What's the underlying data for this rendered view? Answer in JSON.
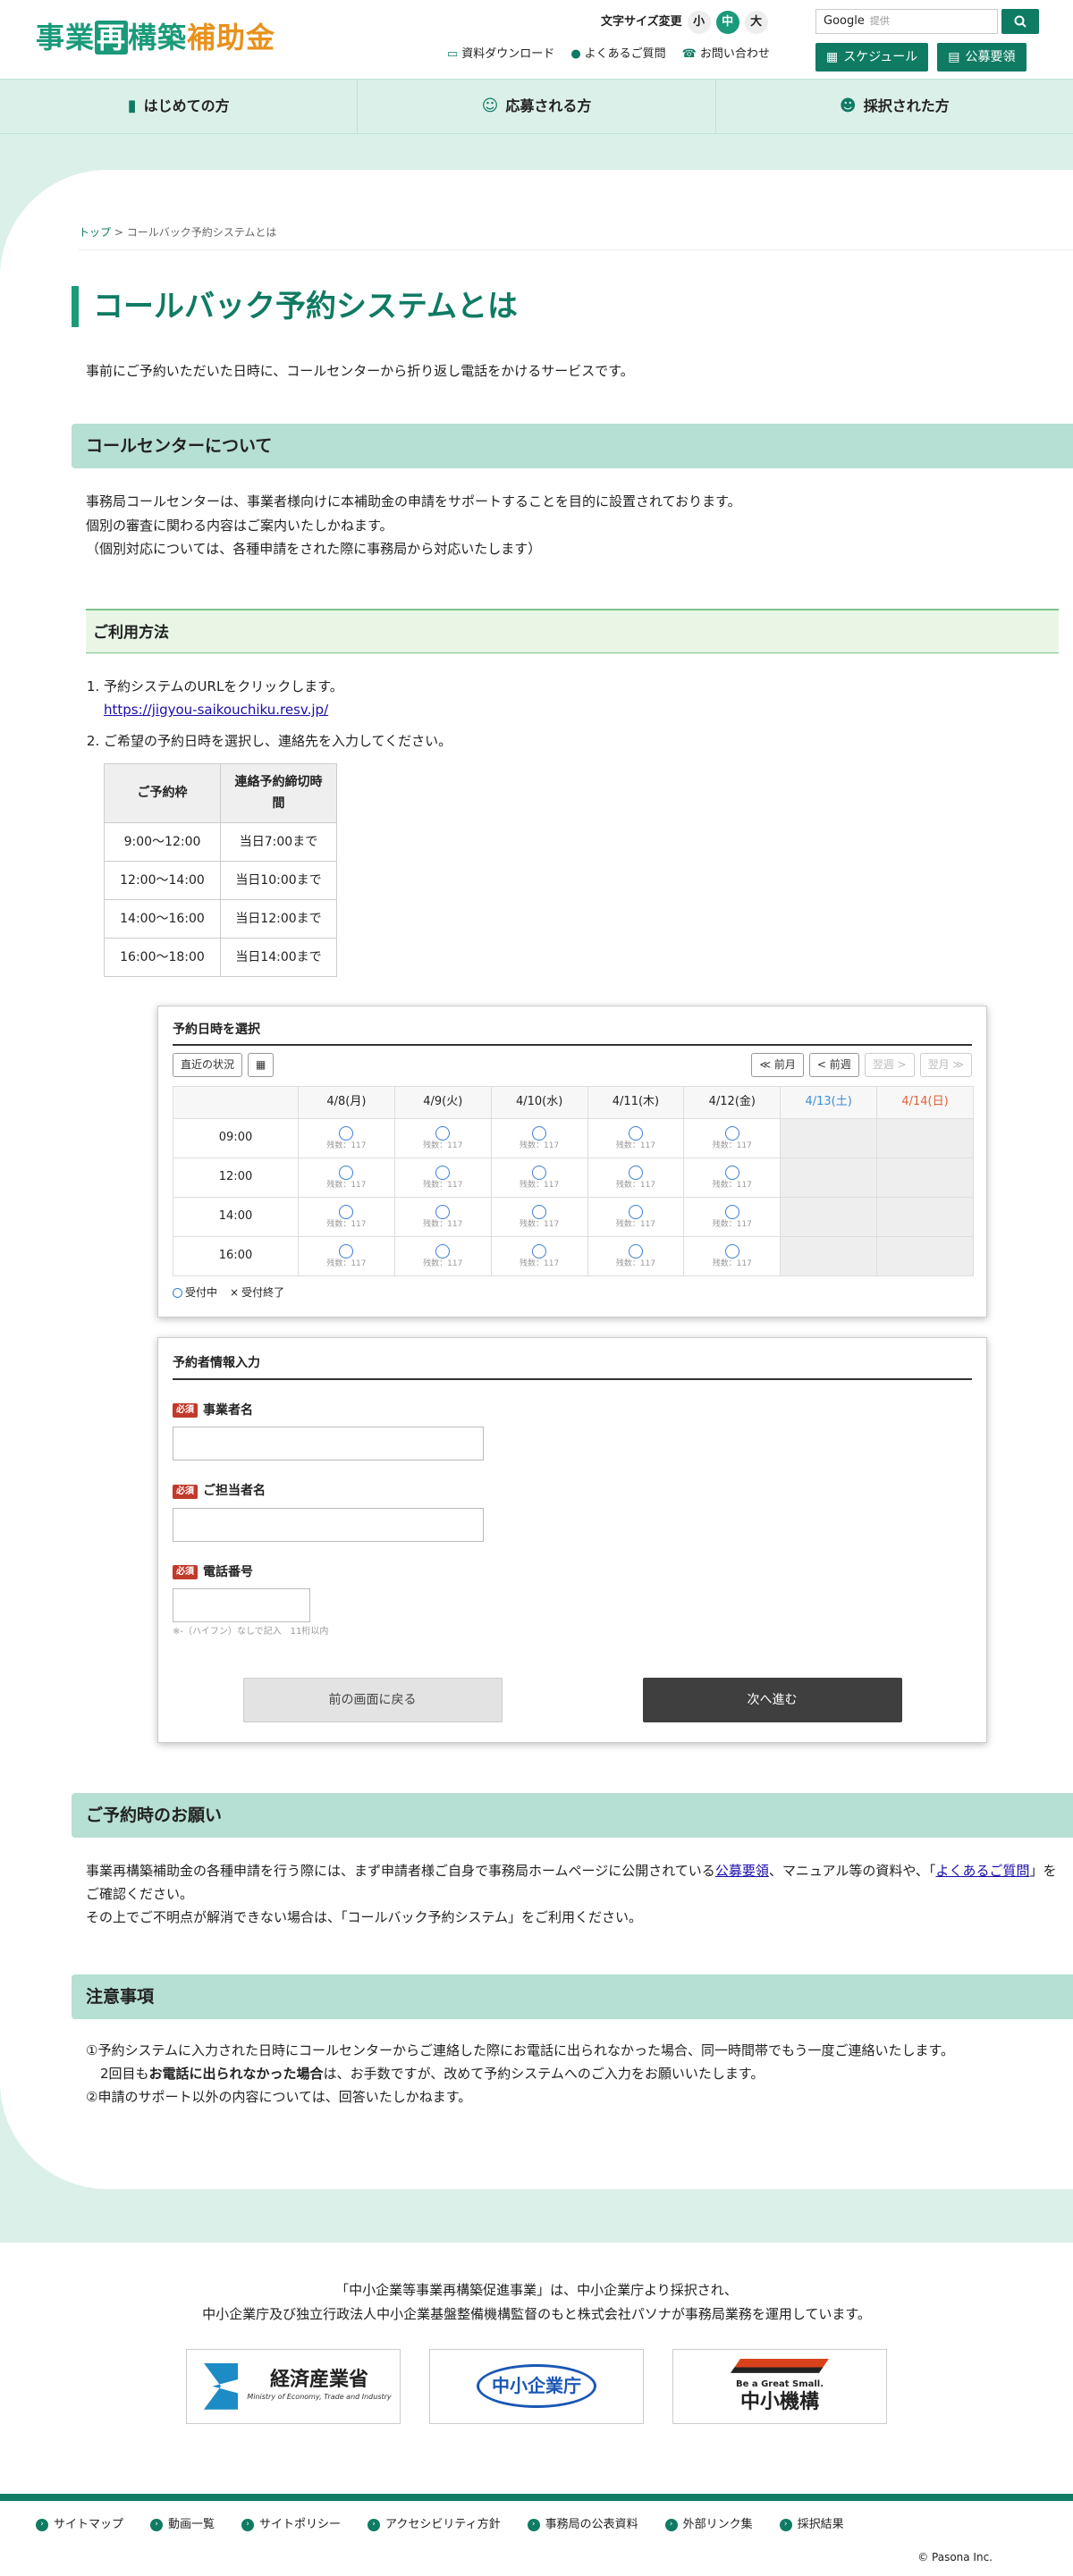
{
  "header": {
    "logo": {
      "part1": "事業",
      "box": "再",
      "part2": "構築",
      "part3": "補助金"
    },
    "font_size_label": "文字サイズ変更",
    "font_sizes": [
      "小",
      "中",
      "大"
    ],
    "search_brand": "Google",
    "search_placeholder": "提供",
    "utils": [
      "資料ダウンロード",
      "よくあるご質問",
      "お問い合わせ"
    ],
    "buttons": [
      "スケジュール",
      "公募要領"
    ]
  },
  "nav": [
    "はじめての方",
    "応募される方",
    "採択された方"
  ],
  "breadcrumb": {
    "home": "トップ",
    "sep": ">",
    "current": "コールバック予約システムとは"
  },
  "page_title": "コールバック予約システムとは",
  "lead": "事前にご予約いただいた日時に、コールセンターから折り返し電話をかけるサービスです。",
  "section_callcenter": {
    "title": "コールセンターについて",
    "lines": [
      "事務局コールセンターは、事業者様向けに本補助金の申請をサポートすることを目的に設置されております。",
      "個別の審査に関わる内容はご案内いたしかねます。",
      "（個別対応については、各種申請をされた際に事務局から対応いたします）"
    ]
  },
  "usage": {
    "title": "ご利用方法",
    "step1": "予約システムのURLをクリックします。",
    "url": "https://jigyou-saikouchiku.resv.jp/",
    "step2": "ご希望の予約日時を選択し、連絡先を入力してください。",
    "table_headers": [
      "ご予約枠",
      "連絡予約締切時間"
    ],
    "table_rows": [
      [
        "9:00〜12:00",
        "当日7:00まで"
      ],
      [
        "12:00〜14:00",
        "当日10:00まで"
      ],
      [
        "14:00〜16:00",
        "当日12:00まで"
      ],
      [
        "16:00〜18:00",
        "当日14:00まで"
      ]
    ]
  },
  "calendar": {
    "title": "予約日時を選択",
    "recent": "直近の状況",
    "nav": [
      "≪ 前月",
      "< 前週",
      "翌週 >",
      "翌月 ≫"
    ],
    "days": [
      "4/8(月)",
      "4/9(火)",
      "4/10(水)",
      "4/11(木)",
      "4/12(金)",
      "4/13(土)",
      "4/14(日)"
    ],
    "times": [
      "09:00",
      "12:00",
      "14:00",
      "16:00"
    ],
    "remaining": "残数：117",
    "legend": [
      "受付中",
      "受付終了"
    ]
  },
  "form": {
    "title": "予約者情報入力",
    "required": "必須",
    "fields": [
      "事業者名",
      "ご担当者名",
      "電話番号"
    ],
    "phone_note": "※-（ハイフン）なしで記入　11桁以内",
    "back": "前の画面に戻る",
    "next": "次へ進む"
  },
  "section_request": {
    "title": "ご予約時のお願い",
    "text1": "事業再構築補助金の各種申請を行う際には、まず申請者様ご自身で事務局ホームページに公開されている",
    "link1": "公募要領",
    "text2": "、マニュアル等の資料や、「",
    "link2": "よくあるご質問",
    "text3": "」をご確認ください。",
    "text4": "その上でご不明点が解消できない場合は、「コールバック予約システム」をご利用ください。"
  },
  "section_notes": {
    "title": "注意事項",
    "note1": "①予約システムに入力された日時にコールセンターからご連絡した際にお電話に出られなかった場合、同一時間帯でもう一度ご連絡いたします。",
    "note1b_pre": "2回目も",
    "note1b_bold": "お電話に出られなかった場合",
    "note1b_post": "は、お手数ですが、改めて予約システムへのご入力をお願いいたします。",
    "note2": "②申請のサポート以外の内容については、回答いたしかねます。"
  },
  "footer": {
    "info1": "「中小企業等事業再構築促進事業」は、中小企業庁より採択され、",
    "info2": "中小企業庁及び独立行政法人中小企業基盤整備機構監督のもと株式会社パソナが事務局業務を運用しています。",
    "meti": "経済産業省",
    "meti_sub": "Ministry of Economy, Trade and Industry",
    "chusho": "中小企業庁",
    "smrj_sub": "Be a Great Small.",
    "smrj": "中小機構",
    "links": [
      "サイトマップ",
      "動画一覧",
      "サイトポリシー",
      "アクセシビリティ方針",
      "事務局の公表資料",
      "外部リンク集",
      "採択結果"
    ],
    "copyright": "© Pasona Inc."
  },
  "colors": {
    "brand_green": "#1a9a7a",
    "dark_green": "#0f7b63",
    "orange": "#e8911c",
    "section_bg": "#b6e0d3"
  }
}
